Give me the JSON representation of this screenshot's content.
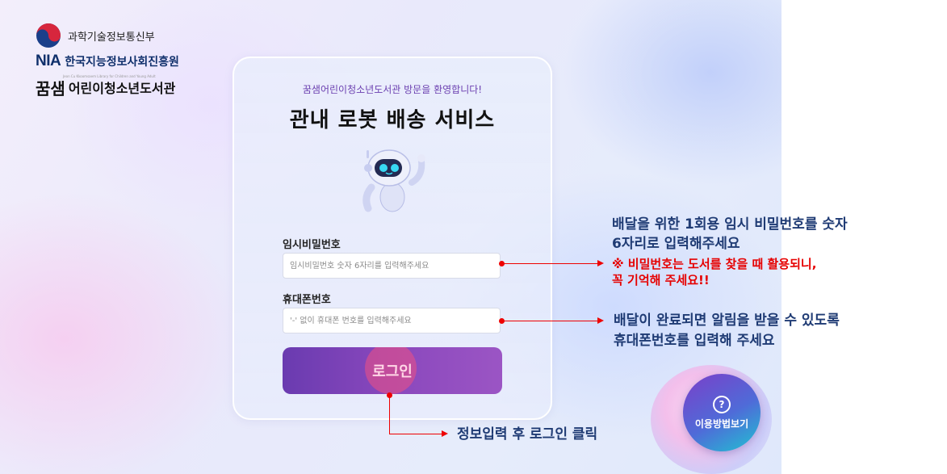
{
  "logos": {
    "gov_name": "과학기술정보통신부",
    "nia_mark": "NIA",
    "nia_name": "한국지능정보사회진흥원",
    "library_mark": "꿈샘",
    "library_name": "어린이청소년도서관",
    "library_sub": "Jeon Cu Kkoomsaem Library for Children and Young Adult"
  },
  "card": {
    "welcome": "꿈샘어린이청소년도서관 방문을 환영합니다!",
    "title": "관내 로봇 배송 서비스",
    "password_label": "임시비밀번호",
    "password_placeholder": "임시비밀번호 숫자 6자리를 입력해주세요",
    "phone_label": "휴대폰번호",
    "phone_placeholder": "'-' 없이 휴대폰 번호를 입력해주세요",
    "login_label": "로그인"
  },
  "annotations": {
    "password_line1": "배달을 위한 1회용 임시 비밀번호를 숫자",
    "password_line2": "6자리로 입력해주세요",
    "password_note1": "※ 비밀번호는 도서를 찾을 때 활용되니,",
    "password_note2": "꼭 기억해 주세요!!",
    "phone_line1": "배달이 완료되면 알림을 받을 수 있도록",
    "phone_line2": "휴대폰번호를 입력해 주세요",
    "login_hint": "정보입력 후 로그인 클릭"
  },
  "help": {
    "icon": "question-circle-icon",
    "label": "이용방법보기"
  },
  "colors": {
    "accent_purple": "#7b45b8",
    "annotation_blue": "#1f3b74",
    "annotation_red": "#e60000"
  }
}
